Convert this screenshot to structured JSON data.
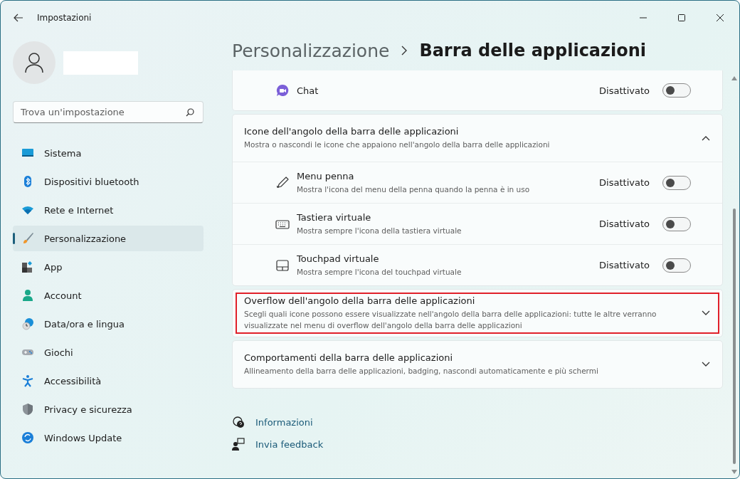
{
  "window": {
    "title": "Impostazioni"
  },
  "search": {
    "placeholder": "Trova un'impostazione"
  },
  "sidebar": {
    "items": [
      {
        "label": "Sistema",
        "selected": false
      },
      {
        "label": "Dispositivi bluetooth",
        "selected": false
      },
      {
        "label": "Rete e Internet",
        "selected": false
      },
      {
        "label": "Personalizzazione",
        "selected": true
      },
      {
        "label": "App",
        "selected": false
      },
      {
        "label": "Account",
        "selected": false
      },
      {
        "label": "Data/ora e lingua",
        "selected": false
      },
      {
        "label": "Giochi",
        "selected": false
      },
      {
        "label": "Accessibilità",
        "selected": false
      },
      {
        "label": "Privacy e sicurezza",
        "selected": false
      },
      {
        "label": "Windows Update",
        "selected": false
      }
    ]
  },
  "breadcrumb": [
    {
      "label": "Personalizzazione"
    },
    {
      "label": "Barra delle applicazioni"
    }
  ],
  "cards": [
    {
      "kind": "rows",
      "rows": [
        {
          "label": "Chat",
          "status": "Disattivato",
          "on": false
        }
      ]
    },
    {
      "kind": "expander",
      "title": "Icone dell'angolo della barra delle applicazioni",
      "description": "Mostra o nascondi le icone che appaiono nell'angolo della barra delle applicazioni",
      "expanded": true,
      "highlighted": false,
      "rows": [
        {
          "label": "Menu penna",
          "description": "Mostra l'icona del menu della penna quando la penna è in uso",
          "status": "Disattivato",
          "on": false
        },
        {
          "label": "Tastiera virtuale",
          "description": "Mostra sempre l'icona della tastiera virtuale",
          "status": "Disattivato",
          "on": false
        },
        {
          "label": "Touchpad virtuale",
          "description": "Mostra sempre l'icona del touchpad virtuale",
          "status": "Disattivato",
          "on": false
        }
      ]
    },
    {
      "kind": "expander",
      "title": "Overflow dell'angolo della barra delle applicazioni",
      "description": "Scegli quali icone possono essere visualizzate nell'angolo della barra delle applicazioni: tutte le altre verranno visualizzate nel menu di overflow dell'angolo della barra delle applicazioni",
      "expanded": false,
      "highlighted": true
    },
    {
      "kind": "expander",
      "title": "Comportamenti della barra delle applicazioni",
      "description": "Allineamento della barra delle applicazioni, badging, nascondi automaticamente e più schermi",
      "expanded": false,
      "highlighted": false
    }
  ],
  "links": [
    {
      "label": "Informazioni"
    },
    {
      "label": "Invia feedback"
    }
  ]
}
